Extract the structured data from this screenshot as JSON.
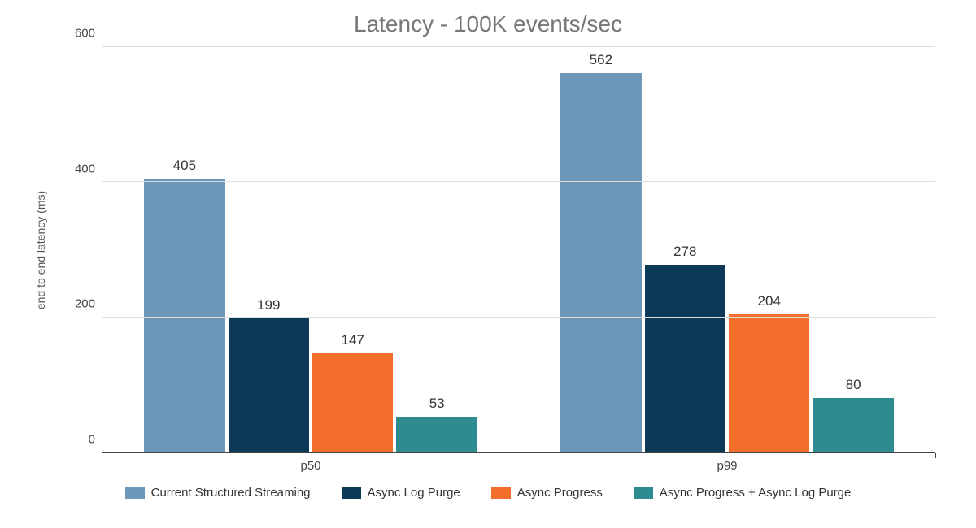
{
  "chart_data": {
    "type": "bar",
    "title": "Latency - 100K events/sec",
    "ylabel": "end to end latency (ms)",
    "xlabel": "",
    "ylim": [
      0,
      600
    ],
    "yticks": [
      0,
      200,
      400,
      600
    ],
    "categories": [
      "p50",
      "p99"
    ],
    "series": [
      {
        "name": "Current Structured Streaming",
        "color": "#6c97b8",
        "values": [
          405,
          562
        ]
      },
      {
        "name": "Async Log Purge",
        "color": "#0c3a56",
        "values": [
          199,
          278
        ]
      },
      {
        "name": "Async Progress",
        "color": "#f36d2b",
        "values": [
          147,
          204
        ]
      },
      {
        "name": "Async Progress + Async Log Purge",
        "color": "#2e8b8f",
        "values": [
          53,
          80
        ]
      }
    ]
  }
}
